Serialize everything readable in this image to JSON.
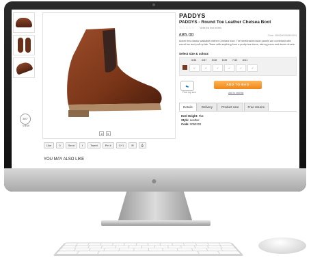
{
  "brand": "PADDYS",
  "product_name": "PADDYS - Round Toe Leather Chelsea Boot",
  "rating": {
    "stars": 0,
    "max": 5,
    "review_link": "Write the first review"
  },
  "price": "£85.00",
  "code_line": "Code: 00502000/00502003",
  "description": "Adorn this classic walkable leather Chelsea boot. The stretchsided side panels are combined with round toe and pull up tab. Team with anything from a pretty tea dress, skinny jeans and denim shorts.",
  "size_label": "Select size & colour:",
  "sizes": [
    "3/36",
    "4/37",
    "5/38",
    "6/39",
    "7/40",
    "8/41"
  ],
  "colour": "#7a3a1f",
  "find_size": "Find my size",
  "add_to_bag": "ADD TO BAG",
  "wishlist": "Add to wishlist",
  "tabs": [
    "Details",
    "Delivery",
    "Product care",
    "Free returns"
  ],
  "active_tab": "Details",
  "details": [
    {
      "label": "Heel Height:",
      "value": "Flat"
    },
    {
      "label": "Style:",
      "value": "Leather"
    },
    {
      "label": "Code:",
      "value": "0050222"
    }
  ],
  "view_360": "360°",
  "view_label": "VIEW",
  "pager": [
    "◂",
    "▸"
  ],
  "share_buttons": [
    "Like",
    "0",
    "Send",
    "t",
    "Tweet",
    "Pin it",
    "G+1",
    "✉",
    "⎙"
  ],
  "you_may_also_like": "YOU MAY ALSO LIKE"
}
